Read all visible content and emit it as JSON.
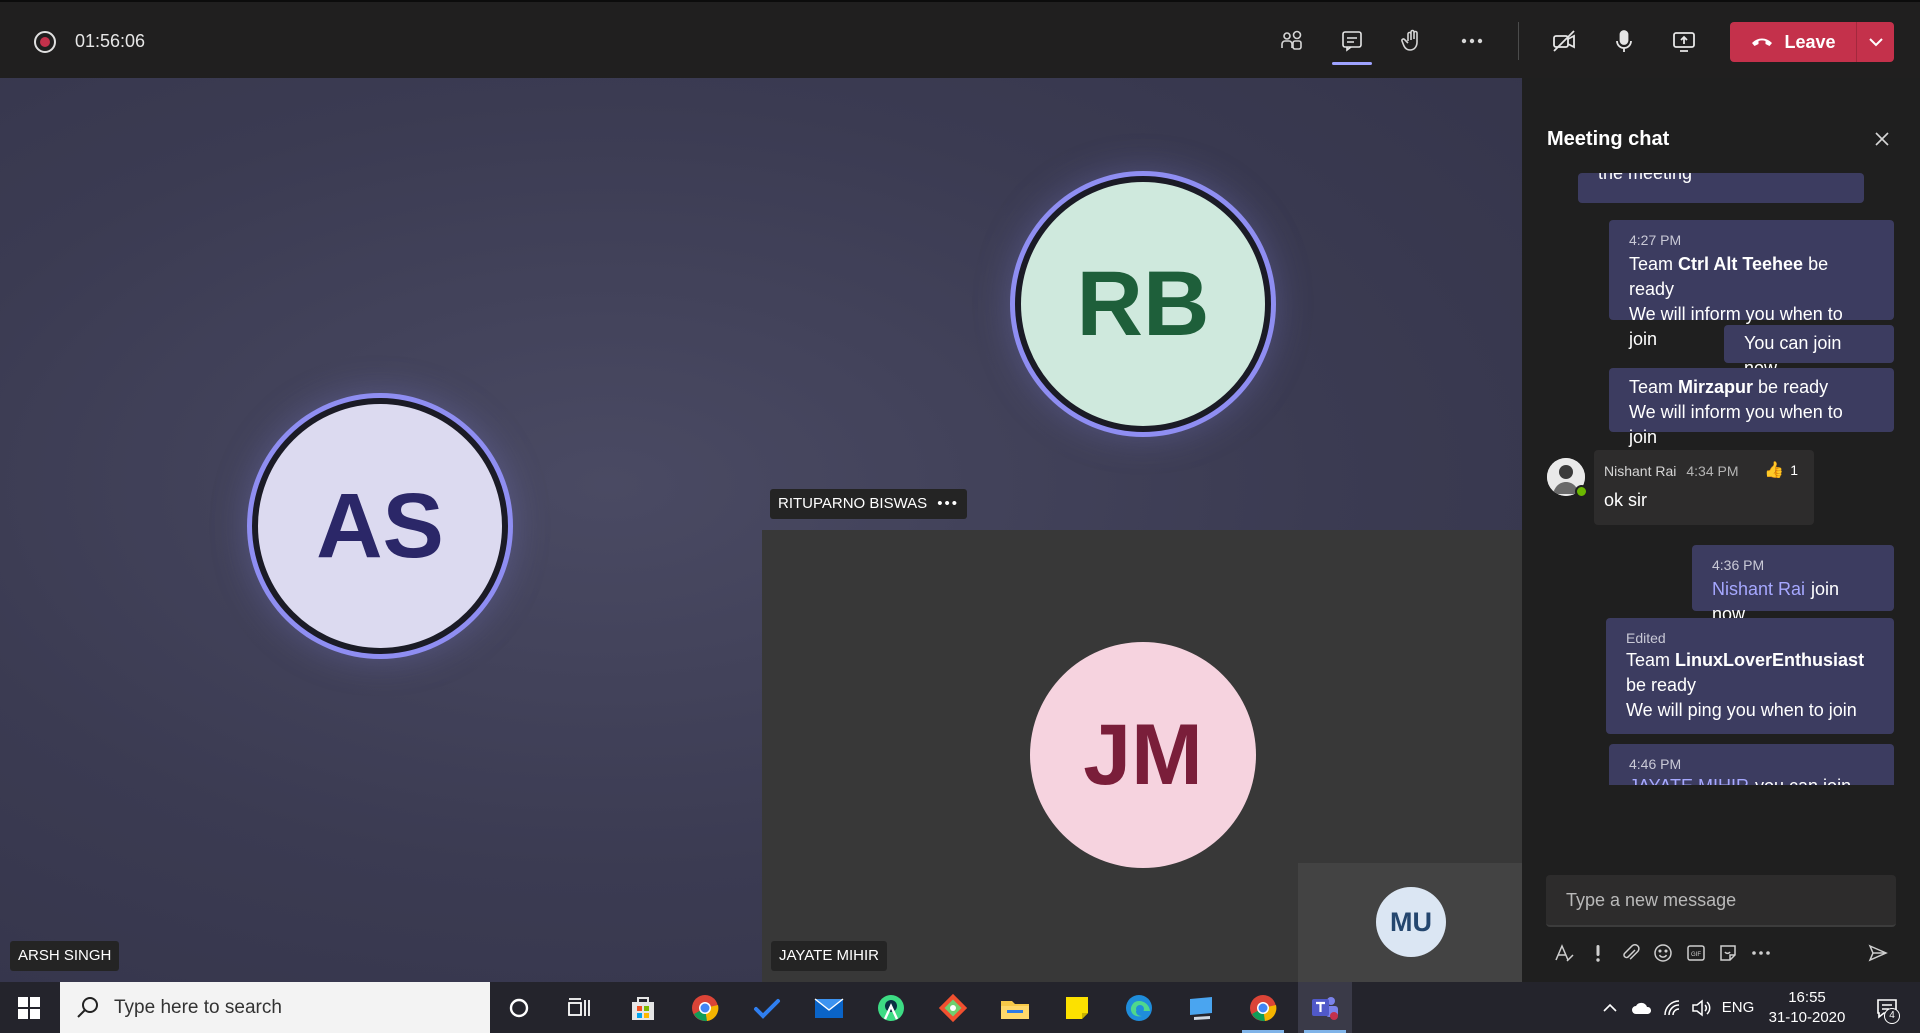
{
  "toolbar": {
    "record_icon": "record-icon",
    "timer": "01:56:06",
    "icons": [
      "participants-icon",
      "chat-icon",
      "raise-hand-icon",
      "more-icon",
      "camera-off-icon",
      "microphone-icon",
      "share-screen-icon"
    ],
    "leave_label": "Leave",
    "leave_color": "#c4314b"
  },
  "stage": {
    "participants": [
      {
        "initials": "AS",
        "name": "ARSH SINGH"
      },
      {
        "initials": "RB",
        "name": "RITUPARNO BISWAS",
        "name_suffix": "•••"
      },
      {
        "initials": "JM",
        "name": "JAYATE MIHIR"
      },
      {
        "initials": "MU"
      }
    ]
  },
  "chat": {
    "title": "Meeting chat",
    "prev_text": "the meeting",
    "messages": [
      {
        "time": "4:27 PM",
        "line1_pre": "Team ",
        "line1_bold": "Ctrl Alt Teehee",
        "line1_post": " be ready",
        "line2": "We will inform you when to join"
      },
      {
        "text": "You can join now"
      },
      {
        "line1_pre": "Team ",
        "line1_bold": "Mirzapur",
        "line1_post": " be ready",
        "line2": "We will inform you when to join"
      },
      {
        "sender": "Nishant Rai",
        "time": "4:34 PM",
        "reaction_icon": "thumbs-up-icon",
        "reaction_count": "1",
        "text": "ok sir"
      },
      {
        "time": "4:36 PM",
        "mention": "Nishant Rai",
        "text": "join now"
      },
      {
        "edited": "Edited",
        "line1_pre": "Team ",
        "line1_bold": "LinuxLoverEnthusiast",
        "line1_post": " be ready",
        "line2": "We will ping you when to join"
      },
      {
        "time": "4:46 PM",
        "mention": "JAYATE MIHIR",
        "text": "you can join now"
      }
    ],
    "compose_placeholder": "Type a new message",
    "compose_tools": [
      "format-icon",
      "important-icon",
      "attach-icon",
      "emoji-icon",
      "gif-icon",
      "sticker-icon",
      "more-icon",
      "send-icon"
    ]
  },
  "taskbar": {
    "search_placeholder": "Type here to search",
    "apps": [
      "cortana-icon",
      "task-view-icon",
      "store-icon",
      "chrome-icon",
      "todo-icon",
      "mail-icon",
      "android-studio-icon",
      "git-icon",
      "file-explorer-icon",
      "sticky-notes-icon",
      "edge-icon",
      "remote-desktop-icon",
      "chrome-icon",
      "teams-icon"
    ],
    "language": "ENG",
    "time": "16:55",
    "date": "31-10-2020",
    "notification_count": "4"
  }
}
